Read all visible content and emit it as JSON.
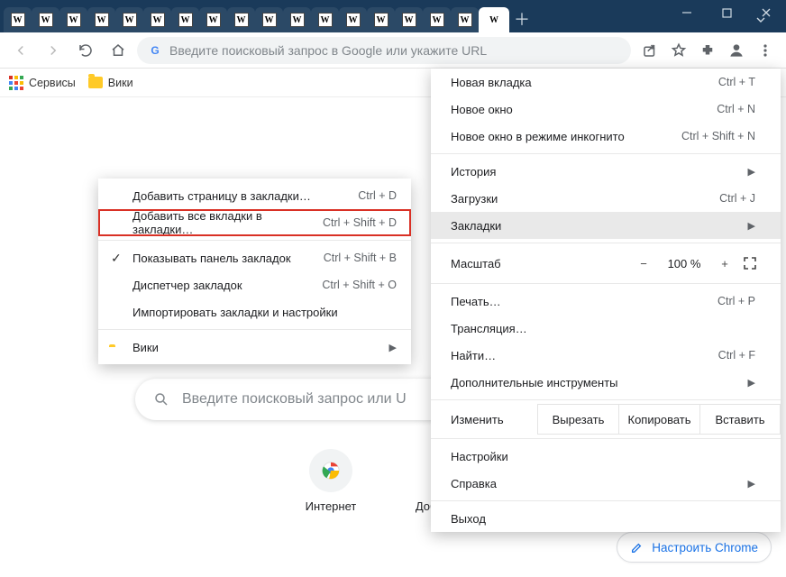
{
  "tabs": {
    "count": 18,
    "logo_letter": "W"
  },
  "omnibox": {
    "placeholder": "Введите поисковый запрос в Google или укажите URL"
  },
  "bookmarksbar": {
    "apps": "Сервисы",
    "wiki": "Вики"
  },
  "page": {
    "search_placeholder": "Введите поисковый запрос или U",
    "shortcut_web": "Интернет",
    "shortcut_add": "Добавить яр…",
    "customize": "Настроить Chrome"
  },
  "menu": {
    "new_tab": {
      "label": "Новая вкладка",
      "sc": "Ctrl + T"
    },
    "new_window": {
      "label": "Новое окно",
      "sc": "Ctrl + N"
    },
    "incognito": {
      "label": "Новое окно в режиме инкогнито",
      "sc": "Ctrl + Shift + N"
    },
    "history": {
      "label": "История"
    },
    "downloads": {
      "label": "Загрузки",
      "sc": "Ctrl + J"
    },
    "bookmarks": {
      "label": "Закладки"
    },
    "zoom": {
      "label": "Масштаб",
      "minus": "−",
      "value": "100 %",
      "plus": "+"
    },
    "print": {
      "label": "Печать…",
      "sc": "Ctrl + P"
    },
    "cast": {
      "label": "Трансляция…"
    },
    "find": {
      "label": "Найти…",
      "sc": "Ctrl + F"
    },
    "more_tools": {
      "label": "Дополнительные инструменты"
    },
    "edit": {
      "label": "Изменить",
      "cut": "Вырезать",
      "copy": "Копировать",
      "paste": "Вставить"
    },
    "settings": {
      "label": "Настройки"
    },
    "help": {
      "label": "Справка"
    },
    "exit": {
      "label": "Выход"
    }
  },
  "submenu": {
    "bookmark_page": {
      "label": "Добавить страницу в закладки…",
      "sc": "Ctrl + D"
    },
    "bookmark_all": {
      "label": "Добавить все вкладки в закладки…",
      "sc": "Ctrl + Shift + D"
    },
    "show_bar": {
      "label": "Показывать панель закладок",
      "sc": "Ctrl + Shift + B"
    },
    "manager": {
      "label": "Диспетчер закладок",
      "sc": "Ctrl + Shift + O"
    },
    "import": {
      "label": "Импортировать закладки и настройки"
    },
    "wiki": {
      "label": "Вики"
    }
  }
}
